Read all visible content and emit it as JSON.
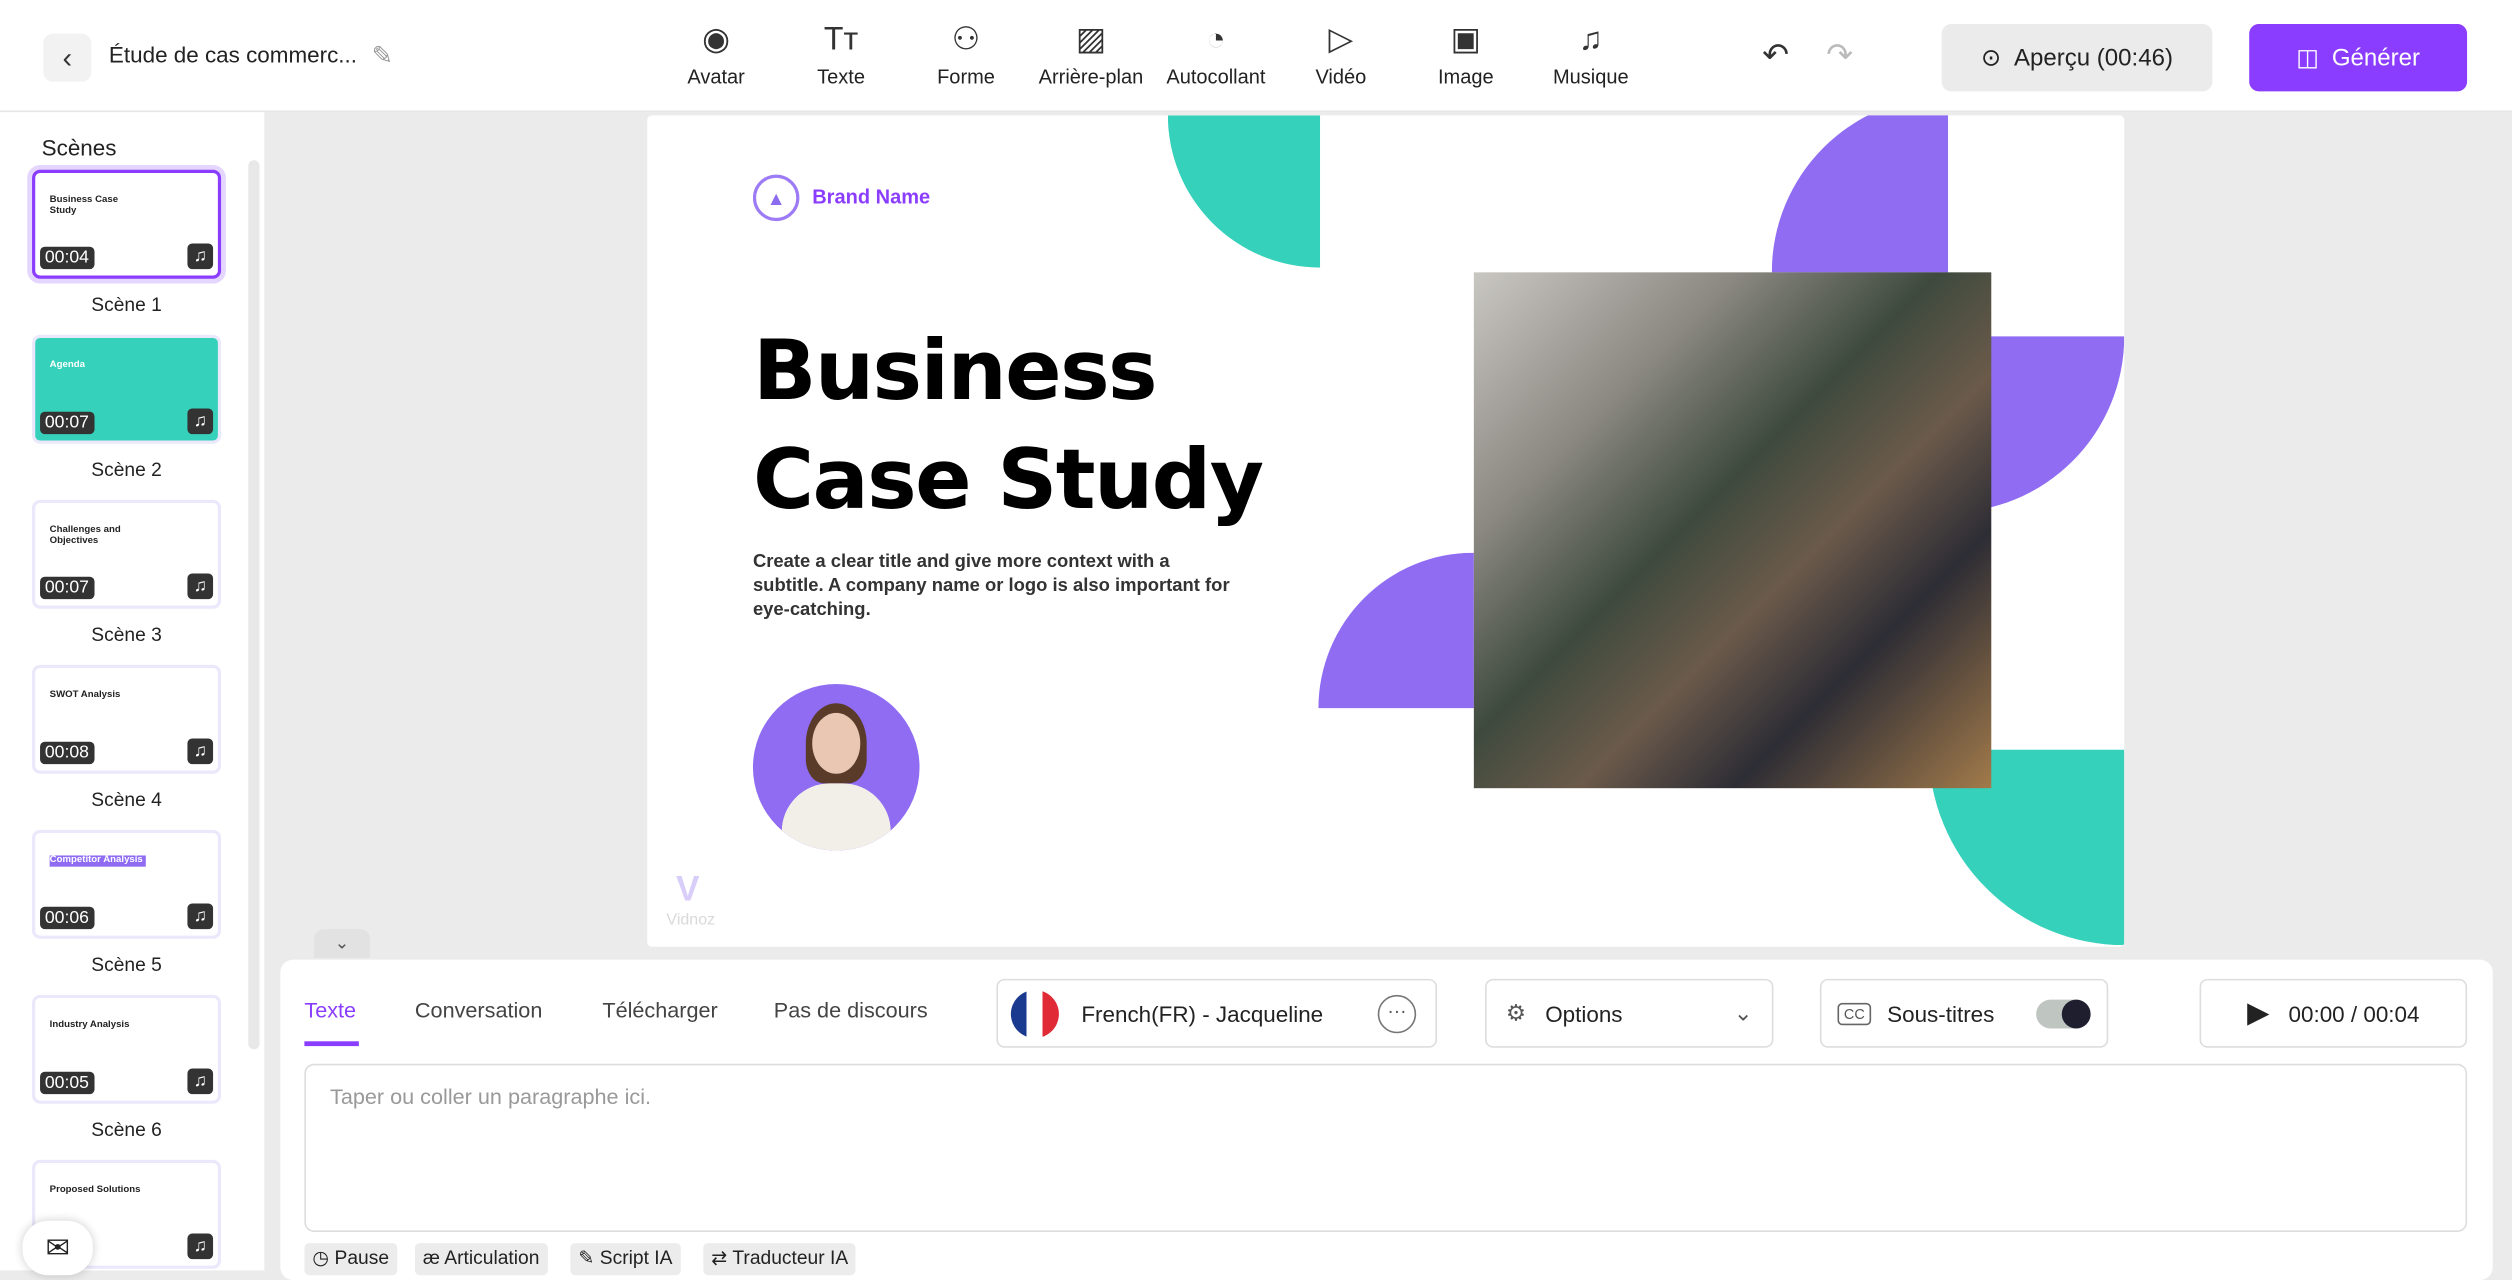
{
  "header": {
    "title": "Étude de cas commerc...",
    "preview_label": "Aperçu (00:46)",
    "generate_label": "Générer",
    "tools": [
      {
        "label": "Avatar",
        "icon": "avatar-icon"
      },
      {
        "label": "Texte",
        "icon": "text-icon"
      },
      {
        "label": "Forme",
        "icon": "shape-icon"
      },
      {
        "label": "Arrière-plan",
        "icon": "background-icon"
      },
      {
        "label": "Autocollant",
        "icon": "sticker-icon"
      },
      {
        "label": "Vidéo",
        "icon": "video-icon"
      },
      {
        "label": "Image",
        "icon": "image-icon"
      },
      {
        "label": "Musique",
        "icon": "music-icon"
      }
    ]
  },
  "sidebar": {
    "title": "Scènes",
    "scenes": [
      {
        "label": "Scène 1",
        "duration": "00:04",
        "thumb_title": "Business Case Study"
      },
      {
        "label": "Scène 2",
        "duration": "00:07",
        "thumb_title": "Agenda"
      },
      {
        "label": "Scène 3",
        "duration": "00:07",
        "thumb_title": "Challenges and Objectives"
      },
      {
        "label": "Scène 4",
        "duration": "00:08",
        "thumb_title": "SWOT Analysis"
      },
      {
        "label": "Scène 5",
        "duration": "00:06",
        "thumb_title": "Competitor Analysis"
      },
      {
        "label": "Scène 6",
        "duration": "00:05",
        "thumb_title": "Industry Analysis"
      },
      {
        "label": "",
        "duration": "",
        "thumb_title": "Proposed Solutions"
      }
    ]
  },
  "slide": {
    "brand": "Brand Name",
    "title_line1": "Business",
    "title_line2": "Case Study",
    "subtitle": "Create a clear title and give more context with a subtitle. A company name or logo is also important for eye-catching.",
    "watermark": "Vidnoz",
    "colors": {
      "teal": "#36d1bb",
      "purple": "#8f6cf2"
    }
  },
  "panel": {
    "tabs": [
      "Texte",
      "Conversation",
      "Télécharger",
      "Pas de discours"
    ],
    "active_tab": "Texte",
    "voice": "French(FR) - Jacqueline",
    "options_label": "Options",
    "subtitles_label": "Sous-titres",
    "subtitles_on": true,
    "time": "00:00 / 00:04",
    "placeholder": "Taper ou coller un paragraphe ici.",
    "chips": [
      "Pause",
      "Articulation",
      "Script IA",
      "Traducteur IA"
    ]
  },
  "accent": "#8b3dff"
}
